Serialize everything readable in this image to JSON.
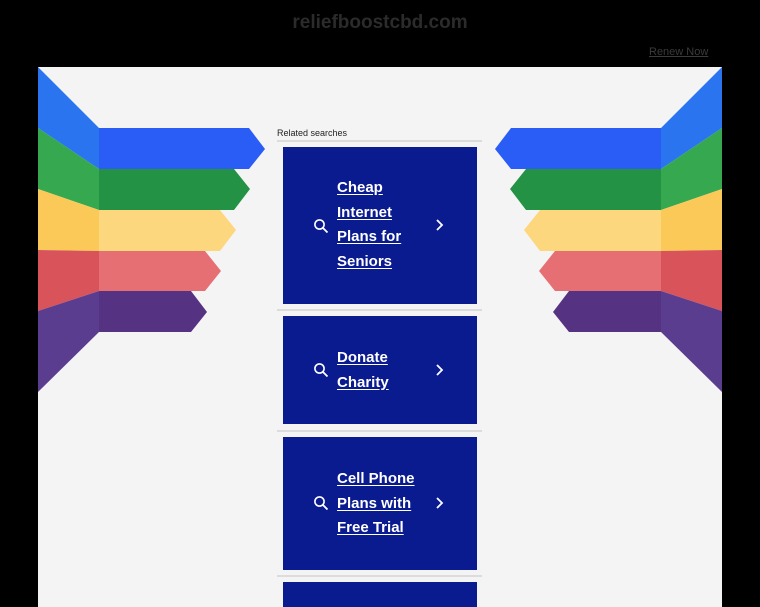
{
  "header": {
    "site_title": "reliefboostcbd.com",
    "renew_label": "Renew Now"
  },
  "related": {
    "label": "Related searches",
    "items": [
      {
        "label": "Cheap Internet Plans for Seniors",
        "icon": "search-icon",
        "chevron": "chevron-right-icon"
      },
      {
        "label": "Donate Charity",
        "icon": "search-icon",
        "chevron": "chevron-right-icon"
      },
      {
        "label": "Cell Phone Plans with Free Trial",
        "icon": "search-icon",
        "chevron": "chevron-right-icon"
      }
    ]
  },
  "colors": {
    "background": "#000000",
    "panel": "#f4f4f4",
    "card": "#0a1a8f",
    "stripes": [
      "#2a74f0",
      "#35a850",
      "#fbc957",
      "#d8545a",
      "#5b3d8f"
    ]
  }
}
